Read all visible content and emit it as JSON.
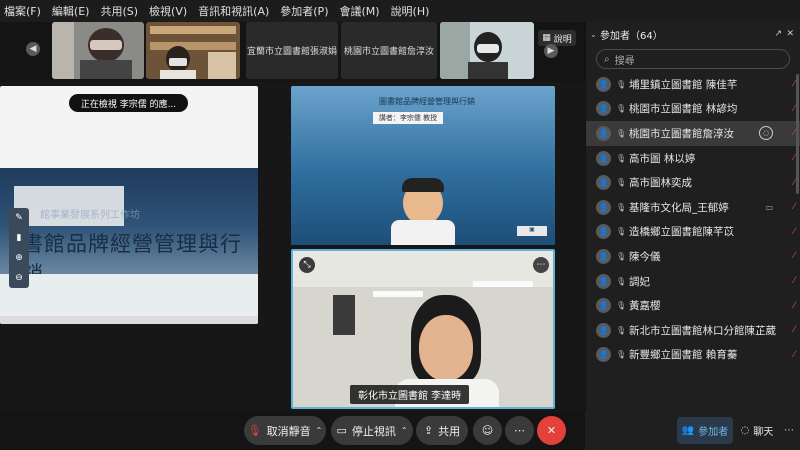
{
  "menu": [
    "檔案(F)",
    "編輯(E)",
    "共用(S)",
    "檢視(V)",
    "音訊和視訊(A)",
    "參加者(P)",
    "會議(M)",
    "說明(H)"
  ],
  "strip": {
    "tile_names": [
      "宜蘭市立圖書館張淑娟",
      "桃園市立圖書館詹淳汝"
    ],
    "speaker_label": "說明"
  },
  "share": {
    "viewing_label": "正在檢視 李宗儒 的應...",
    "slide_title": "書館品牌經營管理與行銷",
    "slide_banner": "館事業發展系列工作坊"
  },
  "video": {
    "tile1_title": "圖書館品牌經營管理與行銷",
    "tile1_subtitle": "講者：李宗儒 教授",
    "tile2_name": "彰化市立圖書館 李達時"
  },
  "toolbar": {
    "unmute": "取消靜音",
    "stop_video": "停止視訊",
    "share": "共用"
  },
  "participants": {
    "header": "參加者（64）",
    "search_placeholder": "搜尋",
    "items": [
      "埔里鎮立圖書館 陳佳芊",
      "桃園市立圖書館 林諺均",
      "桃園市立圖書館詹淳汝",
      "高市圖 林以婷",
      "高市圖林奕成",
      "基隆市文化局_王郁婷",
      "造橋鄉立圖書館陳芊苡",
      "陳今儀",
      "調妃",
      "黃嘉櫻",
      "新北市立圖書館林口分館陳芷葳",
      "新豐鄉立圖書館 賴育蓁"
    ]
  },
  "panel_buttons": {
    "participants": "參加者",
    "chat": "聊天"
  }
}
